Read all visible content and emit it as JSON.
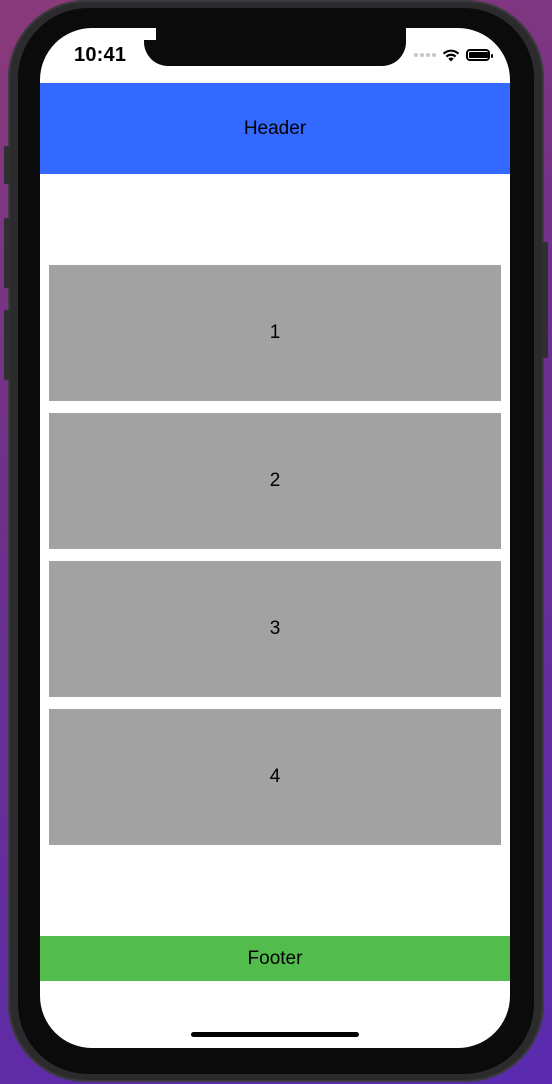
{
  "status_bar": {
    "time": "10:41",
    "icons": [
      "cellular-signal-icon",
      "wifi-icon",
      "battery-icon"
    ]
  },
  "header": {
    "label": "Header",
    "color": "#3369ff"
  },
  "list": {
    "item_color": "#a2a2a2",
    "items": [
      {
        "label": "1"
      },
      {
        "label": "2"
      },
      {
        "label": "3"
      },
      {
        "label": "4"
      }
    ]
  },
  "footer": {
    "label": "Footer",
    "color": "#52bd4d"
  }
}
